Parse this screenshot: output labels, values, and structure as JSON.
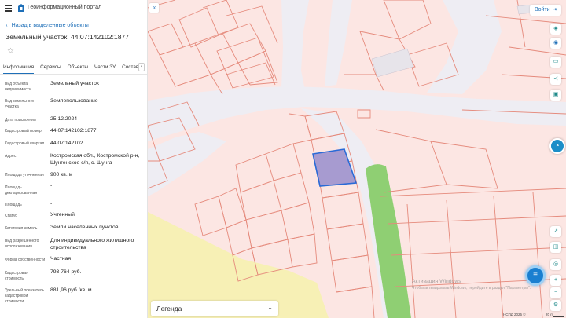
{
  "header": {
    "portal_title": "Геоинформационный портал"
  },
  "panel": {
    "back_link": "Назад в выделенные объекты",
    "title": "Земельный участок: 44:07:142102:1877",
    "tabs": [
      "Информация",
      "Сервисы",
      "Объекты",
      "Части ЗУ",
      "Состав"
    ],
    "attributes": [
      {
        "label": "Вид объекта недвижимости",
        "value": "Земельный участок"
      },
      {
        "label": "Вид земельного участка",
        "value": "Землепользование"
      },
      {
        "label": "Дата присвоения",
        "value": "25.12.2024"
      },
      {
        "label": "Кадастровый номер",
        "value": "44:07:142102:1877"
      },
      {
        "label": "Кадастровый квартал",
        "value": "44:07:142102"
      },
      {
        "label": "Адрес",
        "value": "Костромская обл., Костромской р-н, Шунгенское с/п, с. Шунга"
      },
      {
        "label": "Площадь уточненная",
        "value": "900 кв. м"
      },
      {
        "label": "Площадь декларированная",
        "value": "-"
      },
      {
        "label": "Площадь",
        "value": "-"
      },
      {
        "label": "Статус",
        "value": "Учтенный"
      },
      {
        "label": "Категория земель",
        "value": "Земли населенных пунктов"
      },
      {
        "label": "Вид разрешенного использования",
        "value": "Для индивидуального жилищного строительства"
      },
      {
        "label": "Форма собственности",
        "value": "Частная"
      },
      {
        "label": "Кадастровая стоимость",
        "value": "793 764 руб."
      },
      {
        "label": "Удельный показатель кадастровой стоимости",
        "value": "881,96 руб./кв. м"
      }
    ]
  },
  "map": {
    "login_label": "Войти",
    "legend_label": "Легенда",
    "watermark_title": "Активация Windows",
    "watermark_sub": "Чтобы активировать Windows, перейдите в раздел \"Параметры\".",
    "credit": "НСПД 2025 ©",
    "scale_label": "20 m",
    "colors": {
      "parcel_fill": "#fce6e3",
      "parcel_line": "#e58a7c",
      "road": "#eeedf3",
      "selected_fill": "#a79bd0",
      "selected_line": "#2a6ad6",
      "green_zone": "#8fcf73",
      "sand_zone": "#f7f0b5",
      "accent": "#1e6fb8"
    }
  },
  "icons": [
    "menu-icon",
    "portal-logo-icon",
    "chevron-left-icon",
    "star-icon",
    "chevron-right-icon",
    "double-chevron-left-icon",
    "login-arrow-icon",
    "layers-icon",
    "ruler-icon",
    "print-icon",
    "share-icon",
    "bookmark-icon",
    "chat-icon",
    "chevron-down-icon",
    "list-icon"
  ]
}
